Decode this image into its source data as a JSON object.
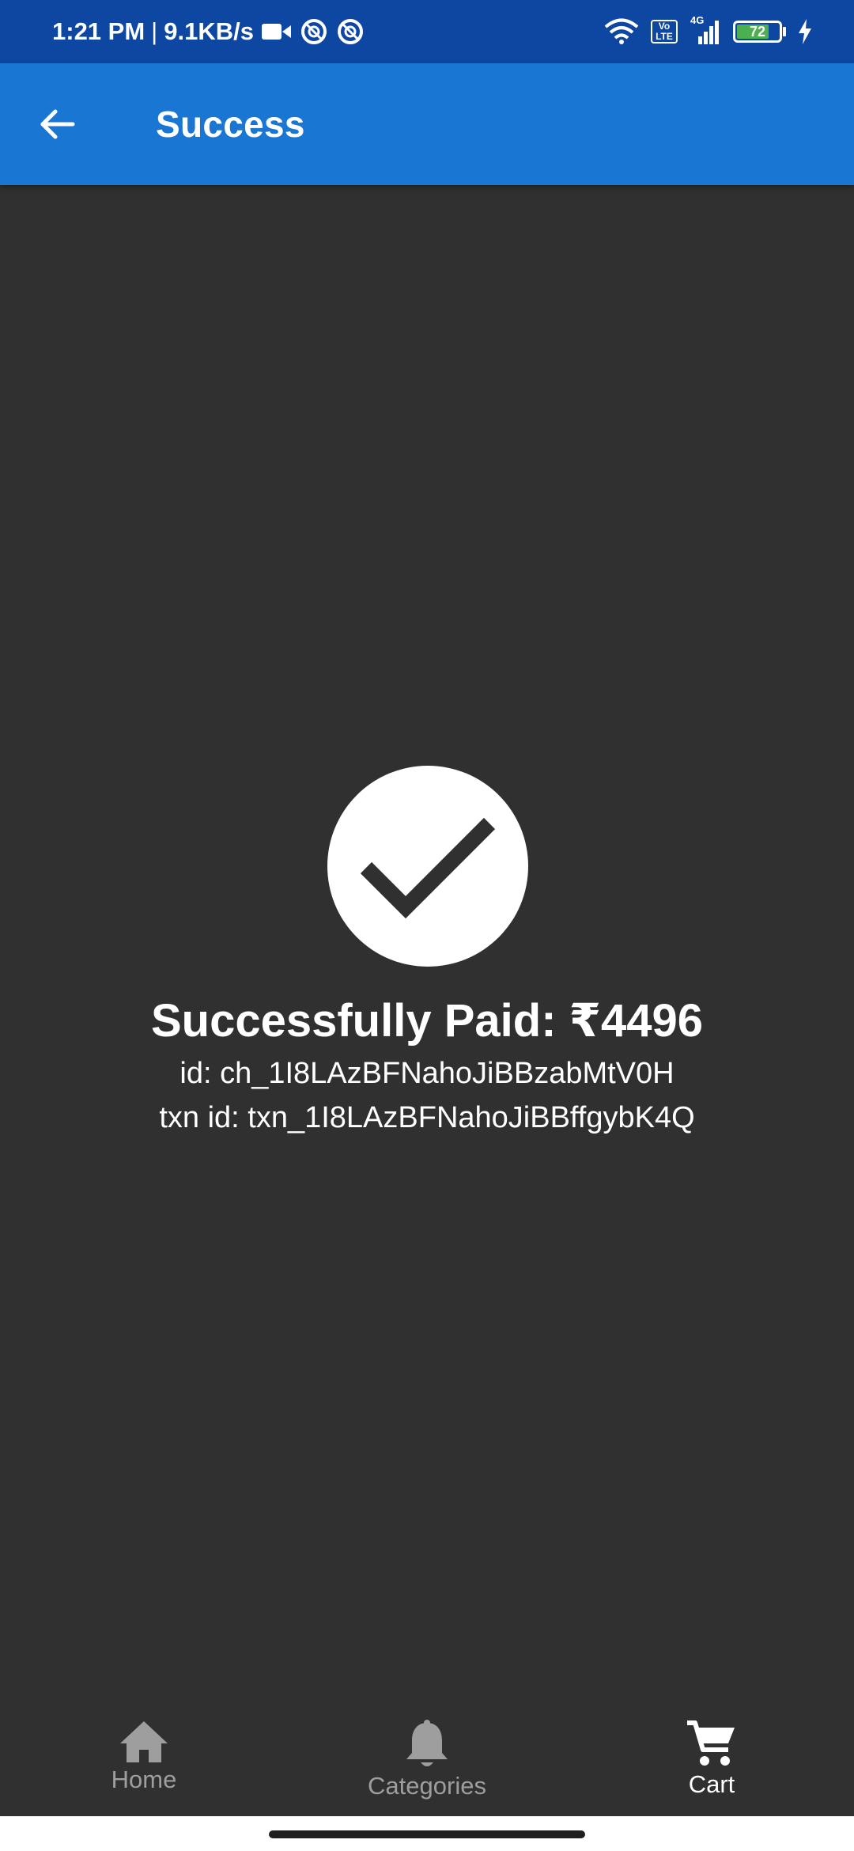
{
  "status_bar": {
    "time": "1:21 PM",
    "separator": "|",
    "speed": "9.1KB/s",
    "volte": "Vo LTE",
    "network": "4G",
    "battery": "72"
  },
  "app_bar": {
    "back_icon": "arrow-back-icon",
    "title": "Success"
  },
  "content": {
    "icon": "check-circle-icon",
    "paid_label": "Successfully Paid: ₹4496",
    "charge_id": "id: ch_1I8LAzBFNahoJiBBzabMtV0H",
    "txn_id": "txn id: txn_1I8LAzBFNahoJiBBffgybK4Q"
  },
  "bottom_nav": {
    "items": [
      {
        "label": "Home",
        "icon": "home-icon",
        "active": false
      },
      {
        "label": "Categories",
        "icon": "bell-icon",
        "active": false
      },
      {
        "label": "Cart",
        "icon": "cart-icon",
        "active": true
      }
    ]
  },
  "colors": {
    "status_bar": "#0d47a1",
    "app_bar": "#1976d2",
    "background": "#303030",
    "nav_inactive": "#9e9e9e",
    "nav_active": "#ffffff"
  }
}
